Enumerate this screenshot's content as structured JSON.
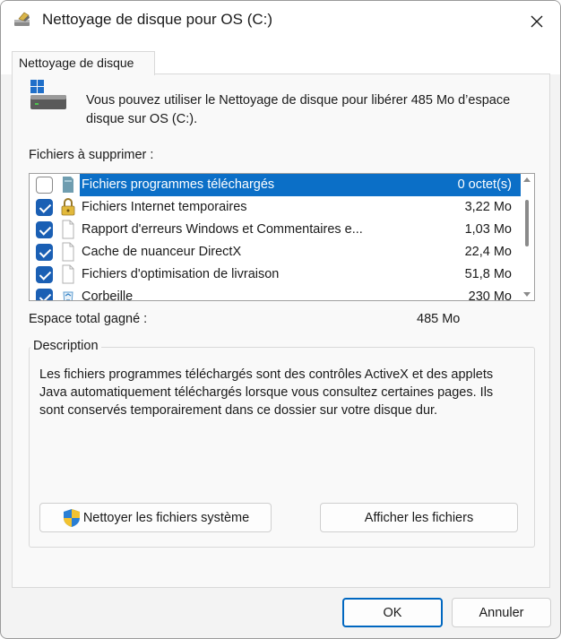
{
  "window": {
    "title": "Nettoyage de disque pour OS (C:)"
  },
  "tab": {
    "label": "Nettoyage de disque"
  },
  "intro": "Vous pouvez utiliser le Nettoyage de disque pour libérer 485 Mo d’espace disque sur OS (C:).",
  "files_label": "Fichiers à supprimer :",
  "files": [
    {
      "name": "Fichiers programmes téléchargés",
      "size": "0 octet(s)",
      "checked": false,
      "selected": true,
      "icon": "folder-icon"
    },
    {
      "name": "Fichiers Internet temporaires",
      "size": "3,22 Mo",
      "checked": true,
      "selected": false,
      "icon": "lock-icon"
    },
    {
      "name": "Rapport d'erreurs Windows et Commentaires e...",
      "size": "1,03 Mo",
      "checked": true,
      "selected": false,
      "icon": "file-icon"
    },
    {
      "name": "Cache de nuanceur DirectX",
      "size": "22,4 Mo",
      "checked": true,
      "selected": false,
      "icon": "file-icon"
    },
    {
      "name": "Fichiers d'optimisation de livraison",
      "size": "51,8 Mo",
      "checked": true,
      "selected": false,
      "icon": "file-icon"
    },
    {
      "name": "Corbeille",
      "size": "230 Mo",
      "checked": true,
      "selected": false,
      "icon": "recycle-bin-icon"
    }
  ],
  "total_label": "Espace total gagné :",
  "total_value": "485 Mo",
  "description": {
    "title": "Description",
    "text": "Les fichiers programmes téléchargés sont des contrôles ActiveX et des applets Java automatiquement téléchargés lorsque vous consultez certaines pages. Ils sont conservés temporairement dans ce dossier sur votre disque dur."
  },
  "buttons": {
    "clean_system": "Nettoyer les fichiers système",
    "show_files": "Afficher les fichiers",
    "ok": "OK",
    "cancel": "Annuler"
  },
  "colors": {
    "accent": "#0b6fc7",
    "checkbox": "#1a5fb4"
  }
}
